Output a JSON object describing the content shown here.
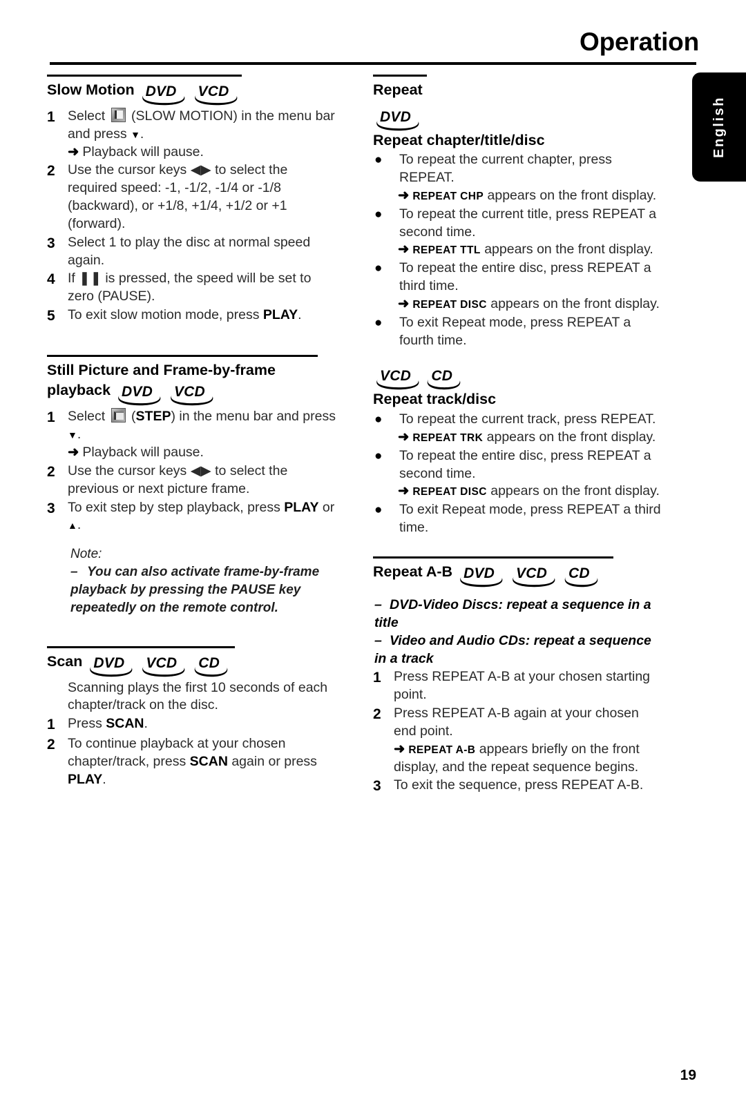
{
  "header": {
    "title": "Operation"
  },
  "side_tab": {
    "label": "English"
  },
  "page_number": "19",
  "left_column": {
    "slow_motion": {
      "heading": "Slow Motion",
      "badges": [
        "DVD",
        "VCD"
      ],
      "steps": [
        {
          "num": "1",
          "text_before_icon": "Select ",
          "icon": "slow-motion-icon",
          "text_after_icon": " (SLOW MOTION) in the menu bar and press ",
          "glyph": "▼",
          "text_end": ".",
          "arrow_note": "Playback will pause."
        },
        {
          "num": "2",
          "text": "Use the cursor keys ◀▶ to select the required speed: -1, -1/2, -1/4 or -1/8 (backward), or +1/8, +1/4, +1/2 or +1 (forward)."
        },
        {
          "num": "3",
          "text": "Select 1 to play the disc at normal speed again."
        },
        {
          "num": "4",
          "text": "If ❚❚ is pressed, the speed will be set to zero (PAUSE)."
        },
        {
          "num": "5",
          "text_a": "To exit slow motion mode, press ",
          "bold": "PLAY",
          "text_b": "."
        }
      ]
    },
    "still_picture": {
      "heading_line1": "Still Picture and Frame-by-frame",
      "heading_line2": "playback",
      "badges": [
        "DVD",
        "VCD"
      ],
      "steps": [
        {
          "num": "1",
          "text_before_icon": "Select ",
          "icon": "step-icon",
          "text_mid": " (",
          "bold": "STEP",
          "text_after": ") in the menu bar and press ",
          "glyph": "▼",
          "text_end": ".",
          "arrow_note": "Playback will pause."
        },
        {
          "num": "2",
          "text": "Use the cursor keys ◀▶ to select the previous or next picture frame."
        },
        {
          "num": "3",
          "text_a": "To exit step by step playback, press ",
          "bold": "PLAY",
          "text_b": " or ",
          "glyph": "▲",
          "text_c": "."
        }
      ],
      "note": {
        "title": "Note:",
        "dash": "–",
        "text": "You can also activate frame-by-frame playback by pressing the PAUSE key repeatedly on the remote control."
      }
    },
    "scan": {
      "heading": "Scan",
      "badges": [
        "DVD",
        "VCD",
        "CD"
      ],
      "intro": "Scanning plays the first 10 seconds of each chapter/track on the disc.",
      "steps": [
        {
          "num": "1",
          "text_a": "Press ",
          "bold": "SCAN",
          "text_b": "."
        },
        {
          "num": "2",
          "text_a": "To continue playback at your chosen chapter/track, press ",
          "bold": "SCAN",
          "text_b": " again or press ",
          "bold2": "PLAY",
          "text_c": "."
        }
      ]
    }
  },
  "right_column": {
    "repeat": {
      "heading": "Repeat",
      "chapter_title_disc": {
        "badges": [
          "DVD"
        ],
        "subheading": "Repeat chapter/title/disc",
        "items": [
          {
            "bullet": "●",
            "text": "To repeat the current chapter, press REPEAT.",
            "arrow_display": "REPEAT CHP",
            "arrow_rest": " appears on the front display."
          },
          {
            "bullet": "●",
            "text": "To repeat the current title, press REPEAT a second time.",
            "arrow_display": "REPEAT TTL",
            "arrow_rest": " appears on the front display."
          },
          {
            "bullet": "●",
            "text": "To repeat the entire disc, press REPEAT a third time.",
            "arrow_display": "REPEAT DISC",
            "arrow_rest": " appears on the front display."
          },
          {
            "bullet": "●",
            "text": "To exit Repeat mode, press REPEAT a fourth time."
          }
        ]
      },
      "track_disc": {
        "badges": [
          "VCD",
          "CD"
        ],
        "subheading": "Repeat track/disc",
        "items": [
          {
            "bullet": "●",
            "text": "To repeat the current track, press REPEAT.",
            "arrow_display": "REPEAT TRK",
            "arrow_rest": " appears on the front display."
          },
          {
            "bullet": "●",
            "text": "To repeat the entire disc, press REPEAT a second time.",
            "arrow_display": "REPEAT DISC",
            "arrow_rest": " appears on the front display."
          },
          {
            "bullet": "●",
            "text": "To exit Repeat mode, press REPEAT a third time."
          }
        ]
      }
    },
    "repeat_ab": {
      "heading": "Repeat A-B",
      "badges": [
        "DVD",
        "VCD",
        "CD"
      ],
      "dash_items": [
        "DVD-Video Discs: repeat a sequence in a title",
        "Video and Audio CDs: repeat a sequence in a track"
      ],
      "steps": [
        {
          "num": "1",
          "text": "Press REPEAT A-B at your chosen starting point."
        },
        {
          "num": "2",
          "text": "Press REPEAT A-B again at your chosen end point.",
          "arrow_display": "REPEAT A-B",
          "arrow_rest": " appears briefly on the front display, and the repeat sequence begins."
        },
        {
          "num": "3",
          "text": "To exit the sequence, press REPEAT A-B."
        }
      ]
    }
  }
}
